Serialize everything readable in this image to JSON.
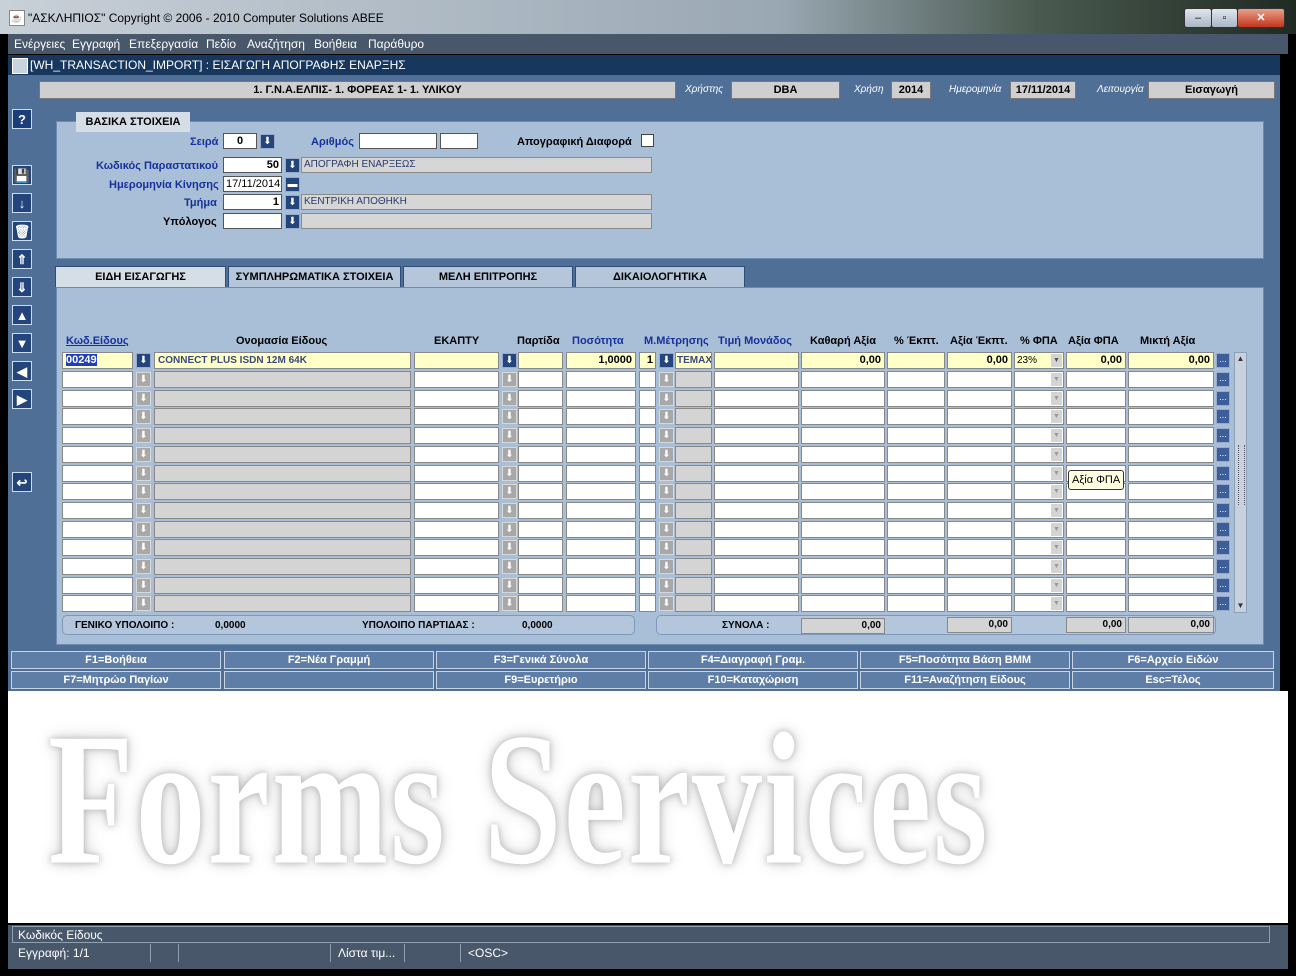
{
  "window": {
    "title": "\"ΑΣΚΛΗΠΙΟΣ\" Copyright © 2006 - 2010 Computer Solutions ΑΒΕΕ",
    "min_glyph": "–",
    "max_glyph": "▫",
    "close_glyph": "✕"
  },
  "menu": [
    "Ενέργειες",
    "Εγγραφή",
    "Επεξεργασία",
    "Πεδίο",
    "Αναζήτηση",
    "Βοήθεια",
    "Παράθυρο"
  ],
  "frame": {
    "title": "[WH_TRANSACTION_IMPORT]   :   ΕΙΣΑΓΩΓΗ ΑΠΟΓΡΑΦΗΣ ΕΝΑΡΞΗΣ"
  },
  "header": {
    "org": "1. Γ.Ν.Α.ΕΛΠΙΣ- 1. ΦΟΡΕΑΣ 1- 1. ΥΛΙΚΟΥ",
    "user_label": "Χρήστης",
    "user": "DBA",
    "year_label": "Χρήση",
    "year": "2014",
    "date_label": "Ημερομηνία",
    "date": "17/11/2014",
    "mode_label": "Λειτουργία",
    "mode": "Εισαγωγή"
  },
  "basic": {
    "caption": "ΒΑΣΙΚΑ ΣΤΟΙΧΕΙΑ",
    "series_label": "Σειρά",
    "series": "0",
    "number_label": "Αριθμός",
    "number": "",
    "number2": "",
    "diff_label": "Απογραφική Διαφορά",
    "doc_code_label": "Κωδικός Παραστατικού",
    "doc_code": "50",
    "doc_desc": "ΑΠΟΓΡΑΦΗ ΕΝΑΡΞΕΩΣ",
    "move_date_label": "Ημερομηνία Κίνησης",
    "move_date": "17/11/2014",
    "dept_label": "Τμήμα",
    "dept": "1",
    "dept_desc": "ΚΕΝΤΡΙΚΗ ΑΠΟΘΗΚΗ",
    "resp_label": "Υπόλογος",
    "resp": "",
    "resp_desc": ""
  },
  "tabs": [
    "ΕΙΔΗ ΕΙΣΑΓΩΓΗΣ",
    "ΣΥΜΠΛΗΡΩΜΑΤΙΚΑ ΣΤΟΙΧΕΙΑ",
    "ΜΕΛΗ ΕΠΙΤΡΟΠΗΣ",
    "ΔΙΚΑΙΟΛΟΓΗΤΙΚΑ"
  ],
  "grid": {
    "headers": {
      "code": "Κωδ.Είδους",
      "name": "Ονομασία Είδους",
      "ekaptu": "ΕΚΑΠΤΥ",
      "batch": "Παρτίδα",
      "qty": "Ποσότητα",
      "unit": "Μ.Μέτρησης",
      "price": "Τιμή Μονάδος",
      "net": "Καθαρή Αξία",
      "disc_pct": "% Έκπτ.",
      "disc_val": "Αξία Έκπτ.",
      "vat_pct": "% ΦΠΑ",
      "vat_val": "Αξία  ΦΠΑ",
      "gross": "Μικτή Αξία"
    },
    "row1": {
      "code": "00249",
      "name": "CONNECT PLUS ISDN 12M 64K",
      "qty": "1,0000",
      "unit_code": "1",
      "unit": "ΤΕΜΑΧ",
      "net": "0,00",
      "disc_val": "0,00",
      "vat_pct": "23%",
      "vat_val": "0,00",
      "gross": "0,00"
    },
    "more_btn": "...",
    "tooltip": "Αξία ΦΠΑ"
  },
  "totals": {
    "general_balance_label": "ΓΕΝΙΚΟ ΥΠΟΛΟΙΠΟ :",
    "general_balance": "0,0000",
    "batch_balance_label": "ΥΠΟΛΟΙΠΟ ΠΑΡΤΙΔΑΣ :",
    "batch_balance": "0,0000",
    "sums_label": "ΣΥΝΟΛΑ :",
    "net": "0,00",
    "disc": "0,00",
    "vat": "0,00",
    "gross": "0,00"
  },
  "fkeys": [
    "F1=Βοήθεια",
    "F2=Νέα Γραμμή",
    "F3=Γενικά Σύνολα",
    "F4=Διαγραφή Γραμ.",
    "F5=Ποσότητα Βάση ΒΜΜ",
    "F6=Αρχείο Ειδών",
    "F7=Μητρώο Παγίων",
    "",
    "F9=Ευρετήριο",
    "F10=Καταχώριση",
    "F11=Αναζήτηση Είδους",
    "Esc=Τέλος"
  ],
  "watermark": "Forms Services",
  "status": {
    "hint": "Κωδικός Είδους",
    "record": "Εγγραφή: 1/1",
    "list": "Λίστα τιμ...",
    "osc": "<OSC>"
  },
  "icons": {
    "help": "?",
    "save": "💾",
    "down": "↓",
    "trash": "🗑",
    "up_first": "⇑",
    "down_last": "⇓",
    "up": "▲",
    "down_tri": "▼",
    "left": "◀",
    "right": "▶",
    "back": "↩"
  }
}
